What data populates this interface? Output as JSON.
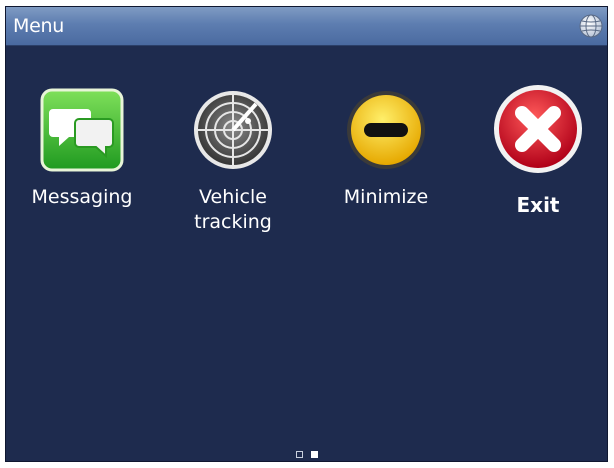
{
  "window": {
    "title": "Menu",
    "title_icon": "globe-icon"
  },
  "menu": {
    "items": [
      {
        "label": "Messaging",
        "icon": "messaging-icon",
        "icon_color": "#34b233"
      },
      {
        "label": "Vehicle\ntracking",
        "icon": "radar-icon",
        "icon_color": "#6f6f6f"
      },
      {
        "label": "Minimize",
        "icon": "minimize-icon",
        "icon_color": "#f5c400"
      },
      {
        "label": "Exit",
        "icon": "exit-icon",
        "icon_color": "#d61a2c"
      }
    ]
  },
  "pager": {
    "pages": 2,
    "current_page": 2
  },
  "colors": {
    "background": "#1e2b4e",
    "titlebar": "#5d7db0"
  }
}
